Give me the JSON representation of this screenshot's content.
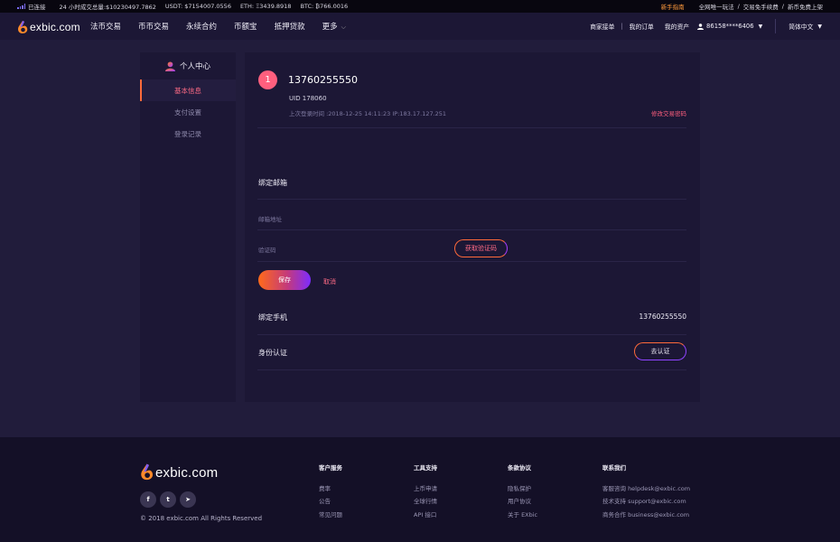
{
  "topbar": {
    "status": "已连接",
    "volume": "24 小时成交总量:$10230497.7862",
    "usdt": "USDT: $7154007.0556",
    "eth": "ETH: Ξ3439.8918",
    "btc": "BTC: ₿766.0016",
    "guide": "新手指南",
    "links": [
      "全网唯一玩法",
      "交易免手续费",
      "新币免费上架"
    ]
  },
  "nav": {
    "brand": "exbic.com",
    "links": [
      "法币交易",
      "币币交易",
      "永续合约",
      "币额宝",
      "抵押贷款"
    ],
    "more": "更多",
    "merchant": "商家接单",
    "orders": "我的订单",
    "assets": "我的资产",
    "account": "86158****6406",
    "language": "简体中文"
  },
  "sidebar": {
    "title": "个人中心",
    "items": [
      "基本信息",
      "支付设置",
      "登录记录"
    ]
  },
  "profile": {
    "avatar_text": "1",
    "phone": "13760255550",
    "uid": "UID 178060",
    "last_login": "上次登录时间 :2018-12-25 14:11:23 IP:183.17.127.251",
    "modify_password": "修改交易密码"
  },
  "email": {
    "title": "绑定邮箱",
    "address_label": "邮箱地址",
    "code_label": "验证码",
    "get_code": "获取验证码",
    "save": "保存",
    "cancel": "取消"
  },
  "bind_phone": {
    "label": "绑定手机",
    "value": "13760255550"
  },
  "identity": {
    "label": "身份认证",
    "button": "去认证"
  },
  "footer": {
    "brand": "exbic.com",
    "copyright": "© 2018 exbic.com All Rights Reserved",
    "social": [
      "f",
      "t",
      "➤"
    ],
    "cols": [
      {
        "title": "客户服务",
        "items": [
          "费率",
          "公告",
          "常见问题"
        ]
      },
      {
        "title": "工具支持",
        "items": [
          "上币申请",
          "全球行情",
          "API 接口"
        ]
      },
      {
        "title": "条款协议",
        "items": [
          "隐私保护",
          "用户协议",
          "关于 EXbic"
        ]
      },
      {
        "title": "联系我们",
        "items": [
          "客服咨询 helpdesk@exbic.com",
          "技术支持 support@exbic.com",
          "商务合作 business@exbic.com"
        ]
      }
    ]
  }
}
